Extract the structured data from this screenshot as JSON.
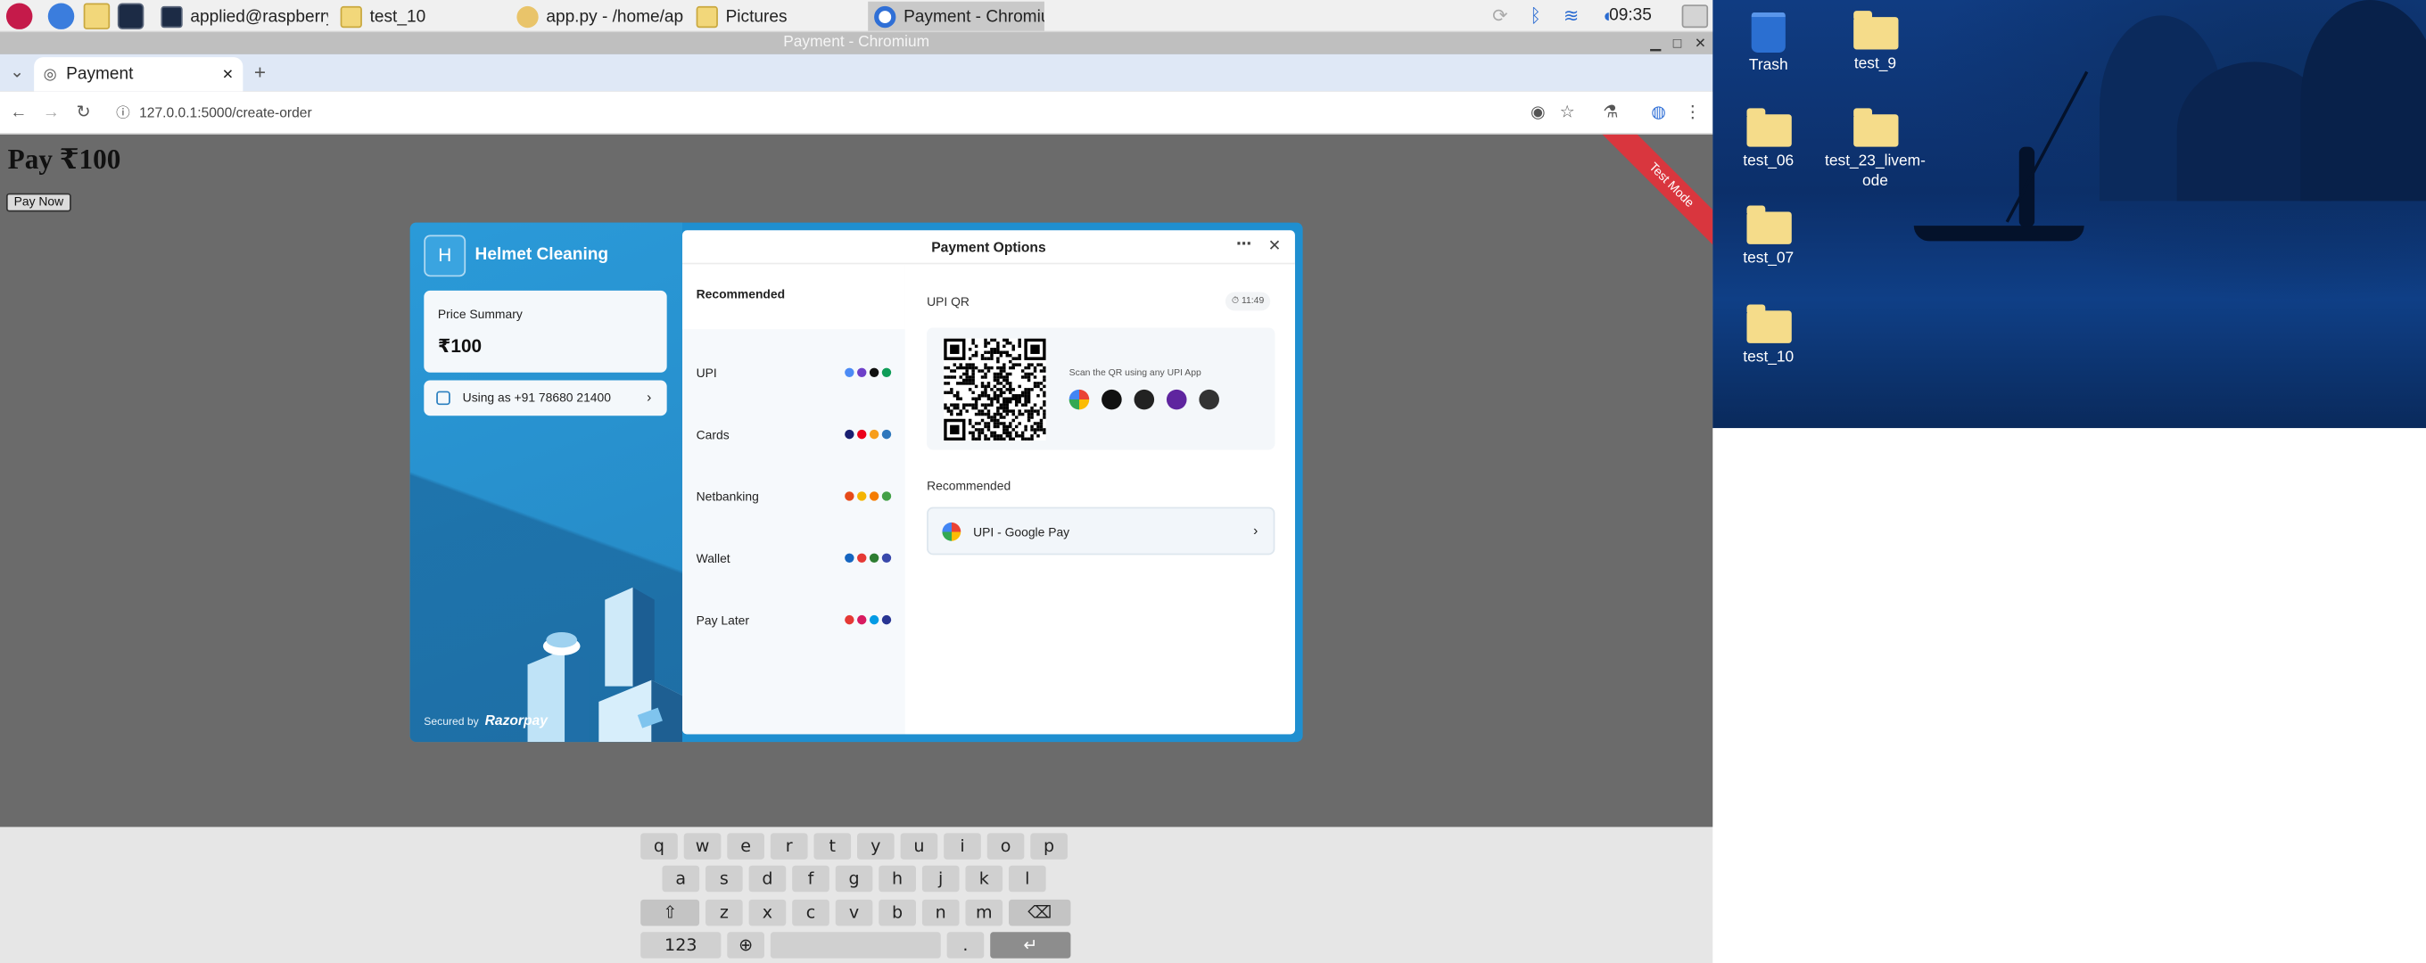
{
  "taskbar": {
    "tasks": [
      {
        "label": "applied@raspberrypi..."
      },
      {
        "label": "test_10"
      },
      {
        "label": "app.py - /home/appli..."
      },
      {
        "label": "Pictures"
      },
      {
        "label": "Payment - Chromium"
      }
    ],
    "clock": "09:35"
  },
  "browser": {
    "window_title": "Payment - Chromium",
    "tab_title": "Payment",
    "url": "127.0.0.1:5000/create-order"
  },
  "page": {
    "heading": "Pay ₹100",
    "pay_button": "Pay Now",
    "ribbon": "Test Mode"
  },
  "checkout": {
    "logo_letter": "H",
    "merchant": "Helmet Cleaning",
    "price_label": "Price Summary",
    "price_value": "₹100",
    "contact": "Using as +91 78680 21400",
    "secured_by": "Secured by",
    "razorpay": "Razorpay",
    "header_title": "Payment Options",
    "methods_title": "Recommended",
    "methods": [
      {
        "label": "UPI",
        "icon_colors": [
          "#4c8bf5",
          "#6e40c9",
          "#111111",
          "#0f9d58"
        ]
      },
      {
        "label": "Cards",
        "icon_colors": [
          "#1a1f71",
          "#eb001b",
          "#f79e1b",
          "#2e77bc"
        ]
      },
      {
        "label": "Netbanking",
        "icon_colors": [
          "#e64a19",
          "#f4b400",
          "#f57c00",
          "#43a047"
        ]
      },
      {
        "label": "Wallet",
        "icon_colors": [
          "#1565c0",
          "#e53935",
          "#2e7d32",
          "#3949ab"
        ]
      },
      {
        "label": "Pay Later",
        "icon_colors": [
          "#e53935",
          "#d81b60",
          "#039be5",
          "#283593"
        ]
      }
    ],
    "qr_title": "UPI QR",
    "qr_timer": "11:49",
    "qr_hint": "Scan the QR using any UPI App",
    "qr_apps": [
      "google-pay",
      "bhim",
      "amazon-pay",
      "phonepe",
      "paytm"
    ],
    "recommended_title": "Recommended",
    "recommended_item": "UPI - Google Pay"
  },
  "keyboard": {
    "row1": [
      "q",
      "w",
      "e",
      "r",
      "t",
      "y",
      "u",
      "i",
      "o",
      "p"
    ],
    "row2": [
      "a",
      "s",
      "d",
      "f",
      "g",
      "h",
      "j",
      "k",
      "l"
    ],
    "row3": [
      "z",
      "x",
      "c",
      "v",
      "b",
      "n",
      "m"
    ],
    "numbers_key": "123",
    "period_key": "."
  },
  "desktop": {
    "icons": [
      "Trash",
      "test_9",
      "test_06",
      "test_23_livem-ode",
      "test_07",
      "test_10"
    ]
  }
}
